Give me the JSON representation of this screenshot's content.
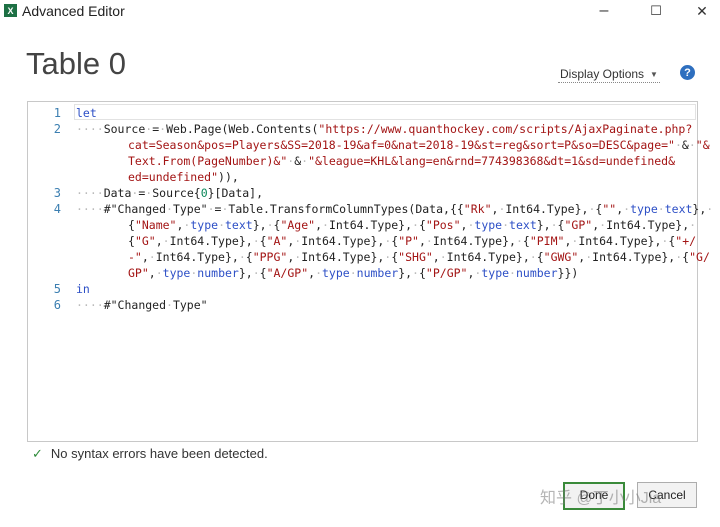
{
  "window": {
    "title": "Advanced Editor",
    "app_icon": "X",
    "minimize": "‒",
    "maximize": "☐",
    "close": "✕"
  },
  "heading": "Table 0",
  "display_options": "Display Options",
  "help": "?",
  "line_numbers": [
    "1",
    "2",
    "3",
    "4",
    "5",
    "6"
  ],
  "status": "No syntax errors have been detected.",
  "buttons": {
    "done": "Done",
    "cancel": "Cancel"
  },
  "watermark": "知乎 @丁小小Jia",
  "colors": {
    "accent": "#2e6fbf",
    "keyword": "#2d4fc6",
    "string": "#a31515",
    "number": "#098658",
    "ok": "#2e8b3a"
  }
}
